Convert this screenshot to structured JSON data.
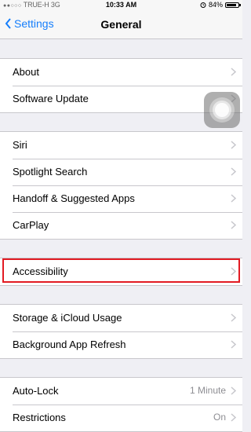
{
  "status_bar": {
    "carrier": "TRUE-H",
    "network": "3G",
    "time": "10:33 AM",
    "battery_text": "84%",
    "battery_level": 0.84
  },
  "nav": {
    "back_label": "Settings",
    "title": "General"
  },
  "groups": [
    {
      "rows": [
        {
          "label": "About"
        },
        {
          "label": "Software Update"
        }
      ]
    },
    {
      "rows": [
        {
          "label": "Siri"
        },
        {
          "label": "Spotlight Search"
        },
        {
          "label": "Handoff & Suggested Apps"
        },
        {
          "label": "CarPlay"
        }
      ]
    },
    {
      "rows": [
        {
          "label": "Accessibility"
        }
      ]
    },
    {
      "rows": [
        {
          "label": "Storage & iCloud Usage"
        },
        {
          "label": "Background App Refresh"
        }
      ]
    },
    {
      "rows": [
        {
          "label": "Auto-Lock",
          "value": "1 Minute"
        },
        {
          "label": "Restrictions",
          "value": "On"
        }
      ]
    }
  ],
  "colors": {
    "accent": "#157efb",
    "highlight": "#e21b23",
    "background": "#efeff4"
  }
}
